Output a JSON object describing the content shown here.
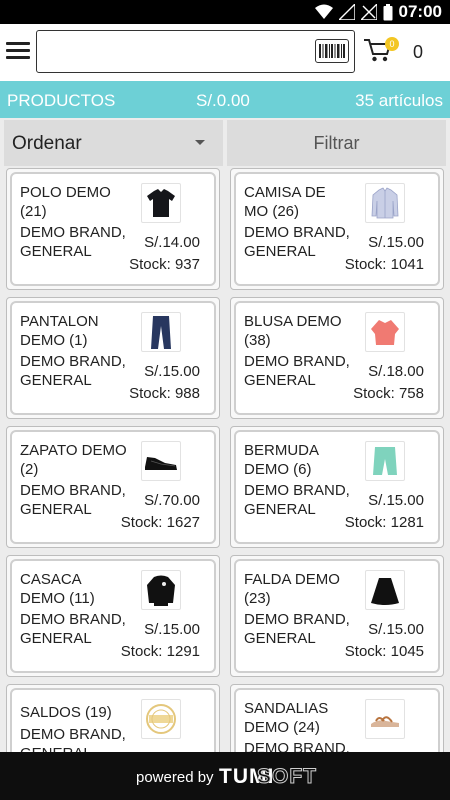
{
  "status_bar": {
    "time": "07:00",
    "icons": [
      "wifi-icon",
      "signal-icon",
      "signal-off-icon",
      "battery-icon"
    ]
  },
  "app_bar": {
    "menu_icon": "hamburger-menu-icon",
    "search": {
      "value": "",
      "placeholder": ""
    },
    "barcode_icon": "barcode-icon",
    "cart_icon": "shopping-cart-icon",
    "cart_badge": "0",
    "cart_count": "0"
  },
  "summary": {
    "title": "PRODUCTOS",
    "total": "S/.0.00",
    "count": "35 artículos",
    "color": "#6dd0d6"
  },
  "toolbar": {
    "sort_label": "Ordenar",
    "filter_label": "Filtrar"
  },
  "products": [
    {
      "name": "POLO DEMO (21)",
      "brand": "DEMO BRAND, GENERAL",
      "price": "S/.14.00",
      "stock": "Stock: 937",
      "icon": "polo-shirt-icon"
    },
    {
      "name": "CAMISA DE MO (26)",
      "brand": "DEMO BRAND, GENERAL",
      "price": "S/.15.00",
      "stock": "Stock: 1041",
      "icon": "dress-shirt-icon"
    },
    {
      "name": "PANTALON DEMO (1)",
      "brand": "DEMO BRAND, GENERAL",
      "price": "S/.15.00",
      "stock": "Stock: 988",
      "icon": "jeans-icon"
    },
    {
      "name": "BLUSA DEMO (38)",
      "brand": "DEMO BRAND, GENERAL",
      "price": "S/.18.00",
      "stock": "Stock: 758",
      "icon": "blouse-icon"
    },
    {
      "name": "ZAPATO DEMO (2)",
      "brand": "DEMO BRAND, GENERAL",
      "price": "S/.70.00",
      "stock": "Stock: 1627",
      "icon": "shoe-icon"
    },
    {
      "name": "BERMUDA DEMO (6)",
      "brand": "DEMO BRAND, GENERAL",
      "price": "S/.15.00",
      "stock": "Stock: 1281",
      "icon": "shorts-icon"
    },
    {
      "name": "CASACA DEMO (11)",
      "brand": "DEMO BRAND, GENERAL",
      "price": "S/.15.00",
      "stock": "Stock: 1291",
      "icon": "jacket-icon"
    },
    {
      "name": "FALDA DEMO (23)",
      "brand": "DEMO BRAND, GENERAL",
      "price": "S/.15.00",
      "stock": "Stock: 1045",
      "icon": "skirt-icon"
    },
    {
      "name": "SALDOS (19)",
      "brand": "DEMO BRAND, GENERAL",
      "price": "",
      "stock": "",
      "icon": "sale-badge-icon"
    },
    {
      "name": "SANDALIAS DEMO (24)",
      "brand": "DEMO BRAND, GENERAL",
      "price": "",
      "stock": "",
      "icon": "sandal-icon"
    }
  ],
  "footer": {
    "powered_by": "powered by",
    "brand_part1": "TUMI",
    "brand_part2": "SOFT"
  }
}
